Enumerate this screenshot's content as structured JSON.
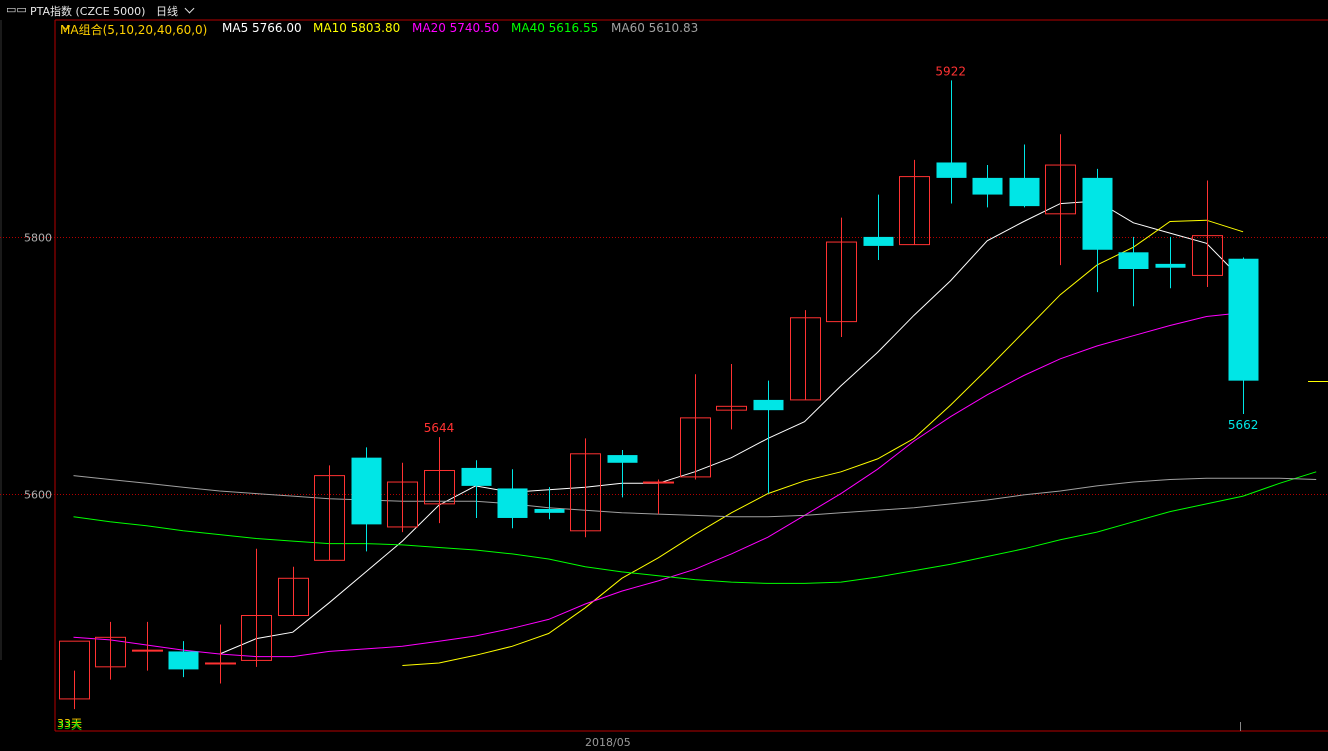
{
  "header": {
    "icon": "window-restore-icon",
    "instrument": "PTA指数 (CZCE 5000)",
    "period": "日线",
    "dropdown_icon": "chevron-down-icon"
  },
  "legend": {
    "group_label": "MA组合(5,10,20,40,60,0)",
    "items": [
      {
        "label": "MA5 5766.00",
        "color": "#ffffff"
      },
      {
        "label": "MA10 5803.80",
        "color": "#ffff00"
      },
      {
        "label": "MA20 5740.50",
        "color": "#ff00ff"
      },
      {
        "label": "MA40 5616.55",
        "color": "#00ff00"
      },
      {
        "label": "MA60 5610.83",
        "color": "#a0a0a0"
      }
    ]
  },
  "corner_labels": {
    "left_bottom_a": "33天",
    "left_bottom_b": "33天"
  },
  "colors": {
    "up": "#ff3232",
    "down": "#00e6e6",
    "frame": "#b40000",
    "grid": "#b40000",
    "background": "#000000"
  },
  "chart_data": {
    "type": "candlestick",
    "ylim": [
      5415,
      5955
    ],
    "y_ticks": [
      5600,
      5800
    ],
    "x_tick_labels": [
      {
        "index": 15,
        "label": "2018/05"
      }
    ],
    "annotations": [
      {
        "index": 10,
        "price": 5644,
        "label": "5644",
        "side": "high"
      },
      {
        "index": 24,
        "price": 5922,
        "label": "5922",
        "side": "high"
      },
      {
        "index": 32,
        "price": 5662,
        "label": "5662",
        "side": "low"
      }
    ],
    "candles": [
      {
        "o": 5440,
        "h": 5462,
        "l": 5432,
        "c": 5485
      },
      {
        "o": 5465,
        "h": 5500,
        "l": 5455,
        "c": 5488
      },
      {
        "o": 5478,
        "h": 5500,
        "l": 5462,
        "c": 5478
      },
      {
        "o": 5477,
        "h": 5485,
        "l": 5457,
        "c": 5463
      },
      {
        "o": 5468,
        "h": 5498,
        "l": 5452,
        "c": 5468
      },
      {
        "o": 5470,
        "h": 5557,
        "l": 5465,
        "c": 5505
      },
      {
        "o": 5505,
        "h": 5543,
        "l": 5505,
        "c": 5534
      },
      {
        "o": 5548,
        "h": 5622,
        "l": 5548,
        "c": 5614
      },
      {
        "o": 5628,
        "h": 5636,
        "l": 5555,
        "c": 5576
      },
      {
        "o": 5574,
        "h": 5624,
        "l": 5570,
        "c": 5609
      },
      {
        "o": 5592,
        "h": 5644,
        "l": 5577,
        "c": 5618
      },
      {
        "o": 5620,
        "h": 5626,
        "l": 5581,
        "c": 5606
      },
      {
        "o": 5604,
        "h": 5619,
        "l": 5573,
        "c": 5581
      },
      {
        "o": 5588,
        "h": 5605,
        "l": 5580,
        "c": 5585
      },
      {
        "o": 5571,
        "h": 5643,
        "l": 5566,
        "c": 5631
      },
      {
        "o": 5630,
        "h": 5634,
        "l": 5597,
        "c": 5624
      },
      {
        "o": 5609,
        "h": 5611,
        "l": 5584,
        "c": 5609
      },
      {
        "o": 5613,
        "h": 5693,
        "l": 5611,
        "c": 5659
      },
      {
        "o": 5665,
        "h": 5701,
        "l": 5650,
        "c": 5668
      },
      {
        "o": 5673,
        "h": 5688,
        "l": 5600,
        "c": 5665
      },
      {
        "o": 5673,
        "h": 5743,
        "l": 5673,
        "c": 5737
      },
      {
        "o": 5734,
        "h": 5815,
        "l": 5722,
        "c": 5796
      },
      {
        "o": 5800,
        "h": 5833,
        "l": 5782,
        "c": 5793
      },
      {
        "o": 5794,
        "h": 5860,
        "l": 5794,
        "c": 5847
      },
      {
        "o": 5858,
        "h": 5922,
        "l": 5826,
        "c": 5846
      },
      {
        "o": 5846,
        "h": 5856,
        "l": 5823,
        "c": 5833
      },
      {
        "o": 5846,
        "h": 5872,
        "l": 5823,
        "c": 5824
      },
      {
        "o": 5818,
        "h": 5880,
        "l": 5778,
        "c": 5856
      },
      {
        "o": 5846,
        "h": 5853,
        "l": 5757,
        "c": 5790
      },
      {
        "o": 5788,
        "h": 5800,
        "l": 5746,
        "c": 5775
      },
      {
        "o": 5779,
        "h": 5800,
        "l": 5760,
        "c": 5776
      },
      {
        "o": 5770,
        "h": 5844,
        "l": 5761,
        "c": 5801
      },
      {
        "o": 5783,
        "h": 5784,
        "l": 5662,
        "c": 5688
      }
    ],
    "series": [
      {
        "name": "MA5",
        "color": "#ffffff",
        "values": [
          null,
          null,
          null,
          null,
          5475,
          5487,
          5492,
          5515,
          5539,
          5563,
          5591,
          5606,
          5601,
          5603,
          5605,
          5608,
          5608,
          5617,
          5628,
          5643,
          5656,
          5684,
          5710,
          5739,
          5766,
          5797,
          5812,
          5826,
          5828,
          5811,
          5803,
          5795,
          5766
        ]
      },
      {
        "name": "MA10",
        "color": "#ffff00",
        "values": [
          null,
          null,
          null,
          null,
          null,
          null,
          null,
          null,
          null,
          5466,
          5468,
          5474,
          5481,
          5491,
          5511,
          5534,
          5550,
          5568,
          5585,
          5600,
          5610,
          5617,
          5627,
          5643,
          5669,
          5697,
          5726,
          5755,
          5778,
          5792,
          5812,
          5813,
          5804
        ]
      },
      {
        "name": "MA20",
        "color": "#ff00ff",
        "values": [
          5488,
          5486,
          5482,
          5478,
          5475,
          5473,
          5473,
          5477,
          5479,
          5481,
          5485,
          5489,
          5495,
          5502,
          5514,
          5524,
          5532,
          5541,
          5553,
          5566,
          5583,
          5600,
          5619,
          5641,
          5660,
          5677,
          5692,
          5705,
          5715,
          5723,
          5731,
          5738,
          5741
        ]
      },
      {
        "name": "MA40",
        "color": "#00ff00",
        "values": [
          5582,
          5578,
          5575,
          5571,
          5568,
          5565,
          5563,
          5561,
          5561,
          5560,
          5558,
          5556,
          5553,
          5549,
          5543,
          5539,
          5536,
          5533,
          5531,
          5530,
          5530,
          5531,
          5535,
          5540,
          5545,
          5551,
          5557,
          5564,
          5570,
          5578,
          5586,
          5592,
          5598,
          5608,
          5617
        ]
      },
      {
        "name": "MA60",
        "color": "#a0a0a0",
        "values": [
          5614,
          5611,
          5608,
          5605,
          5602,
          5600,
          5598,
          5596,
          5595,
          5594,
          5594,
          5594,
          5592,
          5589,
          5587,
          5585,
          5584,
          5583,
          5582,
          5582,
          5583,
          5585,
          5587,
          5589,
          5592,
          5595,
          5599,
          5602,
          5606,
          5609,
          5611,
          5612,
          5612,
          5612,
          5611
        ]
      }
    ],
    "last_price": 5688
  }
}
